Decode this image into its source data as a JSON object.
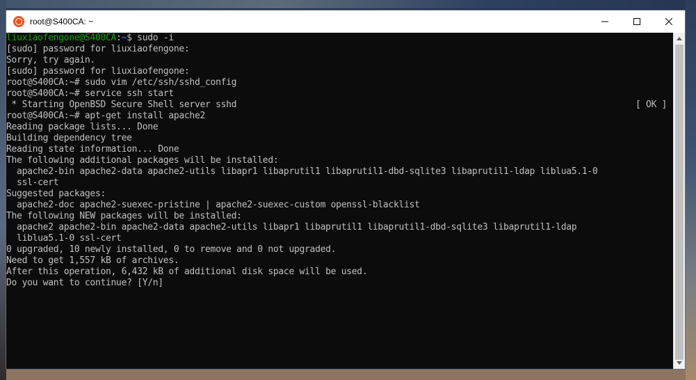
{
  "window": {
    "title": "root@S400CA: ~",
    "icon": "ubuntu-icon",
    "controls": {
      "minimize_icon": "minimize-icon",
      "maximize_icon": "maximize-icon",
      "close_icon": "close-icon"
    }
  },
  "terminal": {
    "lines": [
      {
        "user_host": "liuxiaofengone@S400CA",
        "path": "~",
        "text": "$ sudo -i"
      },
      {
        "text": "[sudo] password for liuxiaofengone:"
      },
      {
        "text": "Sorry, try again."
      },
      {
        "text": "[sudo] password for liuxiaofengone:"
      },
      {
        "text": "root@S400CA:~# sudo vim /etc/ssh/sshd_config"
      },
      {
        "text": "root@S400CA:~# service ssh start"
      },
      {
        "text": " * Starting OpenBSD Secure Shell server sshd",
        "status": "[ OK ]"
      },
      {
        "text": "root@S400CA:~# apt-get install apache2"
      },
      {
        "text": "Reading package lists... Done"
      },
      {
        "text": "Building dependency tree"
      },
      {
        "text": "Reading state information... Done"
      },
      {
        "text": "The following additional packages will be installed:"
      },
      {
        "text": "  apache2-bin apache2-data apache2-utils libapr1 libaprutil1 libaprutil1-dbd-sqlite3 libaprutil1-ldap liblua5.1-0"
      },
      {
        "text": "  ssl-cert"
      },
      {
        "text": "Suggested packages:"
      },
      {
        "text": "  apache2-doc apache2-suexec-pristine | apache2-suexec-custom openssl-blacklist"
      },
      {
        "text": "The following NEW packages will be installed:"
      },
      {
        "text": "  apache2 apache2-bin apache2-data apache2-utils libapr1 libaprutil1 libaprutil1-dbd-sqlite3 libaprutil1-ldap"
      },
      {
        "text": "  liblua5.1-0 ssl-cert"
      },
      {
        "text": "0 upgraded, 10 newly installed, 0 to remove and 0 not upgraded."
      },
      {
        "text": "Need to get 1,557 kB of archives."
      },
      {
        "text": "After this operation, 6,432 kB of additional disk space will be used."
      },
      {
        "text": "Do you want to continue? [Y/n]"
      }
    ]
  },
  "colors": {
    "terminal_bg": "#0c0c0c",
    "terminal_fg": "#c0c0c0",
    "prompt_user": "#13a10e",
    "prompt_path": "#3b78ff",
    "ubuntu_orange": "#e95420"
  },
  "scrollbar": {
    "up_icon": "scroll-up-arrow-icon",
    "down_icon": "scroll-down-arrow-icon"
  }
}
